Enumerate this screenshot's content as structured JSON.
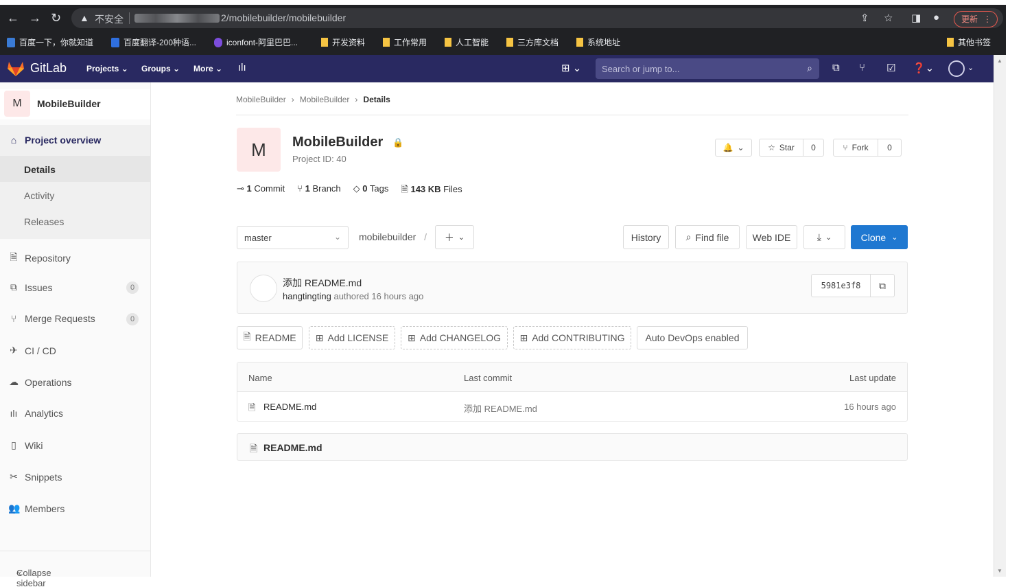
{
  "browser": {
    "insecure_label": "不安全",
    "url": "2/mobilebuilder/mobilebuilder",
    "update_label": "更新",
    "bookmarks": [
      {
        "label": "百度一下，你就知道"
      },
      {
        "label": "百度翻译-200种语..."
      },
      {
        "label": "iconfont-阿里巴巴..."
      },
      {
        "label": "开发资料"
      },
      {
        "label": "工作常用"
      },
      {
        "label": "人工智能"
      },
      {
        "label": "三方库文档"
      },
      {
        "label": "系统地址"
      }
    ],
    "other_bookmarks": "其他书签"
  },
  "header": {
    "brand": "GitLab",
    "nav": [
      {
        "label": "Projects"
      },
      {
        "label": "Groups"
      },
      {
        "label": "More"
      }
    ],
    "search_placeholder": "Search or jump to..."
  },
  "sidebar": {
    "project_initial": "M",
    "project_name": "MobileBuilder",
    "overview_label": "Project overview",
    "sub_items": [
      {
        "label": "Details"
      },
      {
        "label": "Activity"
      },
      {
        "label": "Releases"
      }
    ],
    "items": [
      {
        "label": "Repository"
      },
      {
        "label": "Issues",
        "count": "0"
      },
      {
        "label": "Merge Requests",
        "count": "0"
      },
      {
        "label": "CI / CD"
      },
      {
        "label": "Operations"
      },
      {
        "label": "Analytics"
      },
      {
        "label": "Wiki"
      },
      {
        "label": "Snippets"
      },
      {
        "label": "Members"
      }
    ],
    "collapse_label": "Collapse sidebar"
  },
  "breadcrumb": [
    "MobileBuilder",
    "MobileBuilder",
    "Details"
  ],
  "project": {
    "initial": "M",
    "name": "MobileBuilder",
    "id_label": "Project ID: 40",
    "star_label": "Star",
    "star_count": "0",
    "fork_label": "Fork",
    "fork_count": "0"
  },
  "stats": {
    "commits_num": "1",
    "commits_label": "Commit",
    "branches_num": "1",
    "branches_label": "Branch",
    "tags_num": "0",
    "tags_label": "Tags",
    "size_num": "143 KB",
    "size_label": "Files"
  },
  "repo_toolbar": {
    "branch": "master",
    "path": "mobilebuilder",
    "path_sep": "/",
    "history_label": "History",
    "find_file_label": "Find file",
    "web_ide_label": "Web IDE",
    "clone_label": "Clone"
  },
  "last_commit": {
    "title": "添加 README.md",
    "author": "hangtingting",
    "meta": "authored 16 hours ago",
    "sha": "5981e3f8"
  },
  "quick_buttons": [
    {
      "label": "README"
    },
    {
      "label": "Add LICENSE"
    },
    {
      "label": "Add CHANGELOG"
    },
    {
      "label": "Add CONTRIBUTING"
    },
    {
      "label": "Auto DevOps enabled"
    }
  ],
  "files": {
    "headers": {
      "name": "Name",
      "last_commit": "Last commit",
      "last_update": "Last update"
    },
    "rows": [
      {
        "name": "README.md",
        "commit": "添加 README.md",
        "updated": "16 hours ago"
      }
    ]
  },
  "readme_title": "README.md",
  "colors": {
    "header_bg": "#292961",
    "accent": "#1f78d1",
    "chrome_bg": "#202124"
  }
}
